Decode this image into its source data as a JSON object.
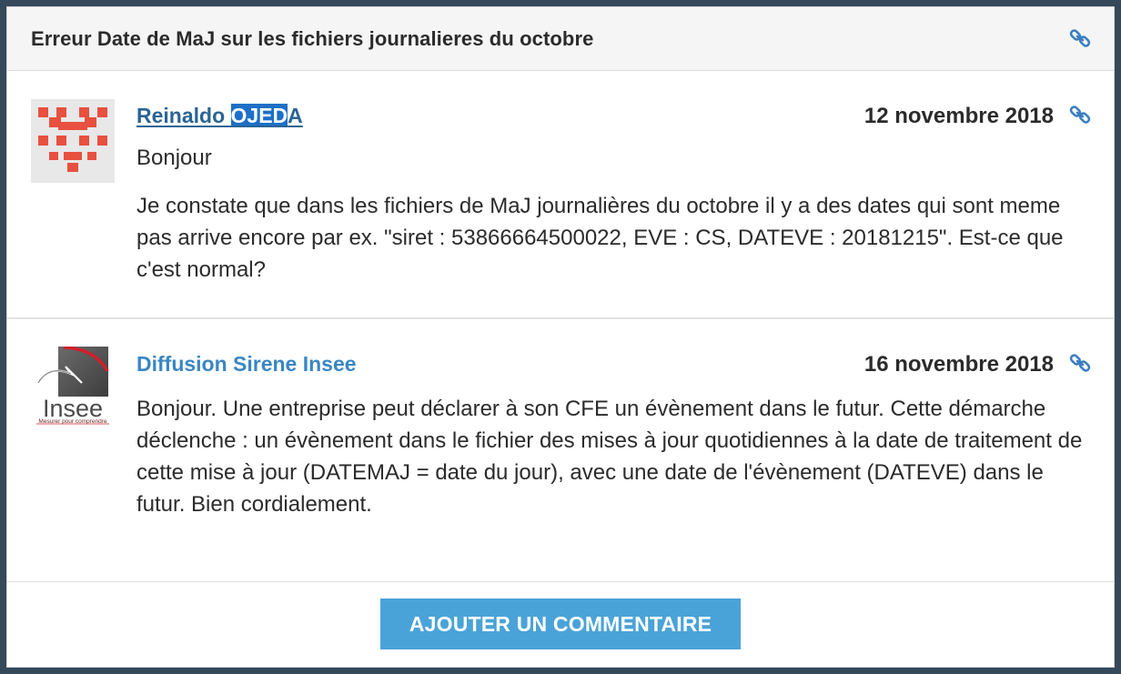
{
  "topic": {
    "title": "Erreur Date de MaJ sur les fichiers journalieres du octobre",
    "link_icon": "link-icon"
  },
  "comments": [
    {
      "author_prefix": "Reinaldo ",
      "author_highlight": "OJED",
      "author_suffix": "A",
      "date": "12 novembre 2018",
      "greeting": "Bonjour",
      "message": "Je constate que dans les fichiers de MaJ journalières du octobre il y a des dates qui sont meme pas arrive encore par ex. \"siret : 53866664500022, EVE : CS, DATEVE : 20181215\". Est-ce que c'est normal?",
      "avatar_icon": "identicon-avatar",
      "avatar_color": "#e8503f"
    },
    {
      "author": "Diffusion Sirene Insee",
      "date": "16 novembre 2018",
      "message": "Bonjour. Une entreprise peut déclarer à son CFE un évènement dans le futur. Cette démarche déclenche : un évènement dans le fichier des mises à jour quotidiennes à la date de traitement de cette mise à jour (DATEMAJ = date du jour), avec une date de l'évènement (DATEVE) dans le futur. Bien cordialement.",
      "avatar_icon": "insee-logo",
      "logo_text": "Insee",
      "logo_tagline": "Mesurer pour comprendre"
    }
  ],
  "footer": {
    "add_comment_label": "AJOUTER UN COMMENTAIRE"
  },
  "colors": {
    "accent": "#4aa3d8",
    "link": "#2a6496",
    "author_blue": "#3a86c3",
    "highlight": "#1d6fc7"
  }
}
